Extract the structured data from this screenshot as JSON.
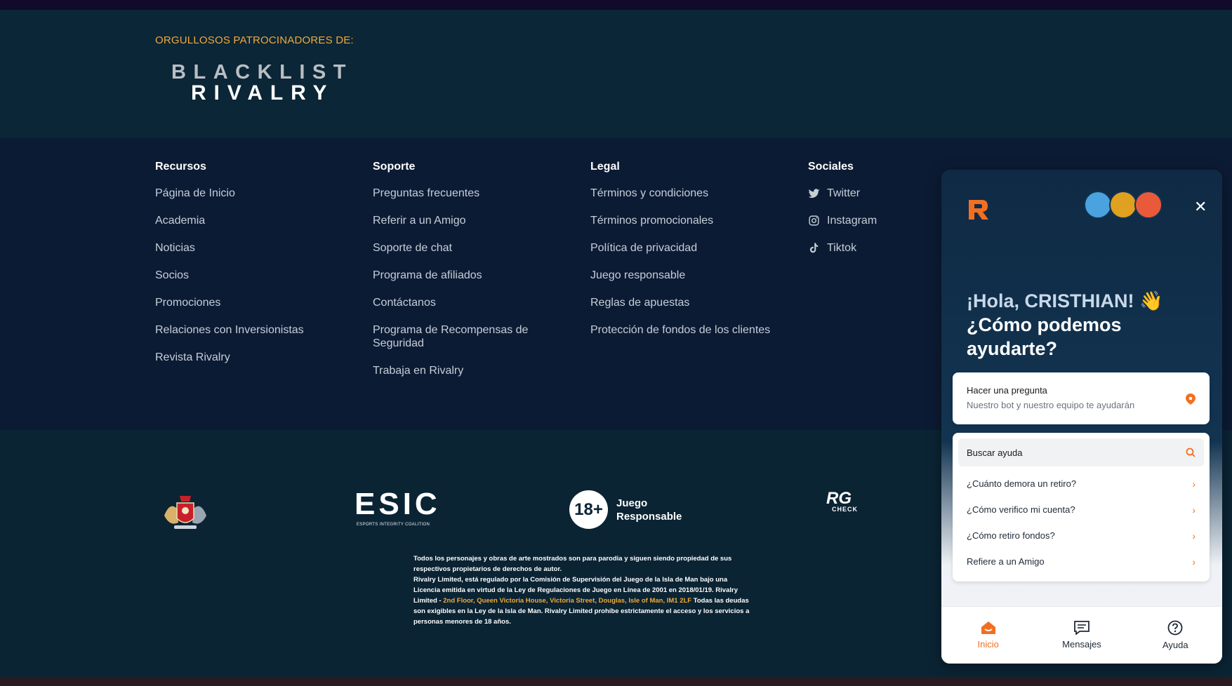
{
  "sponsor": {
    "label": "ORGULLOSOS PATROCINADORES DE:",
    "logo_line1": "BLACKLIST",
    "logo_line2": "RIVALRY"
  },
  "footer": {
    "columns": [
      {
        "title": "Recursos",
        "items": [
          "Página de Inicio",
          "Academia",
          "Noticias",
          "Socios",
          "Promociones",
          "Relaciones con Inversionistas",
          "Revista Rivalry"
        ]
      },
      {
        "title": "Soporte",
        "items": [
          "Preguntas frecuentes",
          "Referir a un Amigo",
          "Soporte de chat",
          "Programa de afiliados",
          "Contáctanos",
          "Programa de Recompensas de Seguridad",
          "Trabaja en Rivalry"
        ]
      },
      {
        "title": "Legal",
        "items": [
          "Términos y condiciones",
          "Términos promocionales",
          "Política de privacidad",
          "Juego responsable",
          "Reglas de apuestas",
          "Protección de fondos de los clientes"
        ]
      }
    ],
    "social": {
      "title": "Sociales",
      "items": [
        "Twitter",
        "Instagram",
        "Tiktok"
      ]
    }
  },
  "badges": {
    "esic_name": "ESIC",
    "esic_sub": "ESPORTS INTEGRITY COALITION",
    "age": "18+",
    "age_line1": "Juego",
    "age_line2": "Responsable",
    "rg": "RG",
    "rg_sub": "CHECK"
  },
  "legal": {
    "p1": "Todos los personajes y obras de arte mostrados son para parodia y siguen siendo propiedad de sus respectivos propietarios de derechos de autor.",
    "p2a": "Rivalry Limited, está regulado por la Comisión de Supervisión del Juego de la Isla de Man bajo una Licencia emitida en virtud de la Ley de Regulaciones de Juego en Línea de 2001 en 2018/01/19. Rivalry Limited - ",
    "address": "2nd Floor, Queen Victoria House, Victoria Street, Douglas, Isle of Man, IM1 2LF",
    "p2b": " Todas las deudas son exigibles en la Ley de la Isla de Man. Rivalry Limited prohíbe estrictamente el acceso y los servicios a personas menores de 18 años."
  },
  "chat": {
    "close": "✕",
    "greeting_line1": "¡Hola, CRISTHIAN! 👋",
    "greeting_line2": "¿Cómo podemos ayudarte?",
    "ask_title": "Hacer una pregunta",
    "ask_sub": "Nuestro bot y nuestro equipo te ayudarán",
    "search_label": "Buscar ayuda",
    "faqs": [
      "¿Cuánto demora un retiro?",
      "¿Cómo verifico mi cuenta?",
      "¿Cómo retiro fondos?",
      "Refiere a un Amigo"
    ],
    "nav": [
      "Inicio",
      "Mensajes",
      "Ayuda"
    ],
    "accent": "#f26f21"
  }
}
